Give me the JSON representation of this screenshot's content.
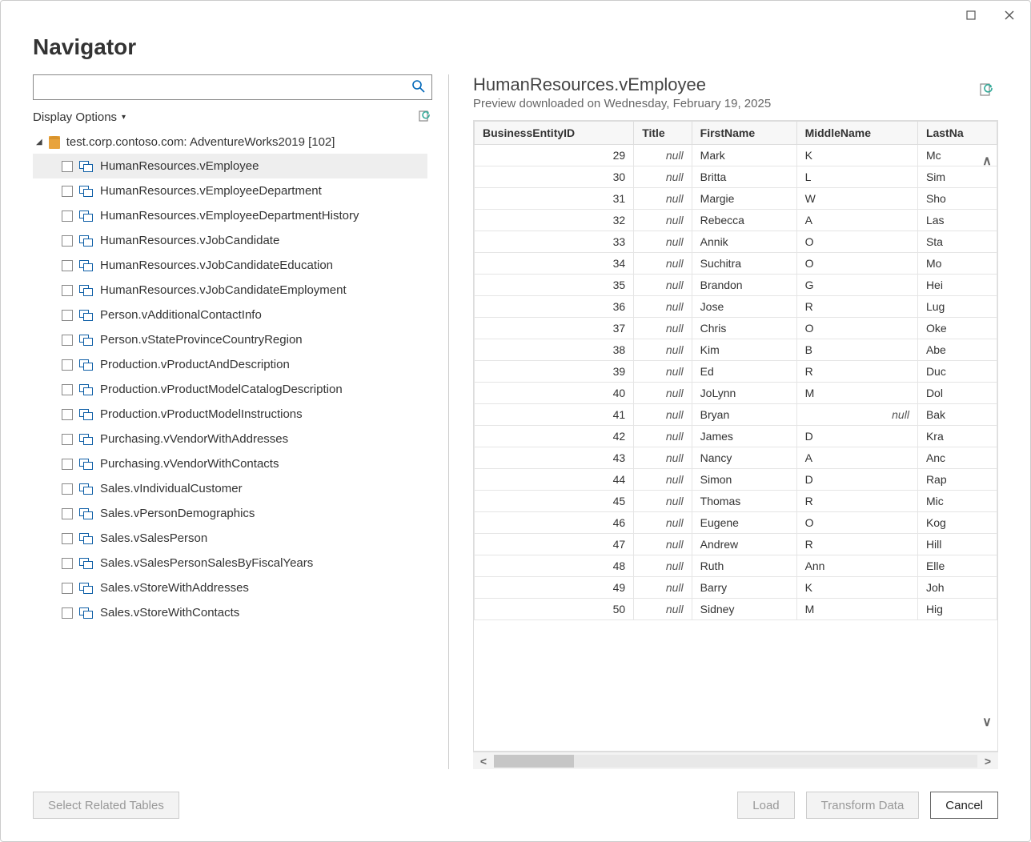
{
  "window": {
    "title": "Navigator"
  },
  "search": {
    "placeholder": ""
  },
  "displayOptions": {
    "label": "Display Options"
  },
  "tree": {
    "root": {
      "label": "test.corp.contoso.com: AdventureWorks2019 [102]"
    },
    "items": [
      {
        "label": "HumanResources.vEmployee",
        "selected": true
      },
      {
        "label": "HumanResources.vEmployeeDepartment"
      },
      {
        "label": "HumanResources.vEmployeeDepartmentHistory"
      },
      {
        "label": "HumanResources.vJobCandidate"
      },
      {
        "label": "HumanResources.vJobCandidateEducation"
      },
      {
        "label": "HumanResources.vJobCandidateEmployment"
      },
      {
        "label": "Person.vAdditionalContactInfo"
      },
      {
        "label": "Person.vStateProvinceCountryRegion"
      },
      {
        "label": "Production.vProductAndDescription"
      },
      {
        "label": "Production.vProductModelCatalogDescription"
      },
      {
        "label": "Production.vProductModelInstructions"
      },
      {
        "label": "Purchasing.vVendorWithAddresses"
      },
      {
        "label": "Purchasing.vVendorWithContacts"
      },
      {
        "label": "Sales.vIndividualCustomer"
      },
      {
        "label": "Sales.vPersonDemographics"
      },
      {
        "label": "Sales.vSalesPerson"
      },
      {
        "label": "Sales.vSalesPersonSalesByFiscalYears"
      },
      {
        "label": "Sales.vStoreWithAddresses"
      },
      {
        "label": "Sales.vStoreWithContacts"
      }
    ]
  },
  "preview": {
    "title": "HumanResources.vEmployee",
    "subtitle": "Preview downloaded on Wednesday, February 19, 2025",
    "columns": [
      "BusinessEntityID",
      "Title",
      "FirstName",
      "MiddleName",
      "LastNa"
    ],
    "rows": [
      {
        "id": "29",
        "title": null,
        "first": "Mark",
        "middle": "K",
        "last": "Mc"
      },
      {
        "id": "30",
        "title": null,
        "first": "Britta",
        "middle": "L",
        "last": "Sim"
      },
      {
        "id": "31",
        "title": null,
        "first": "Margie",
        "middle": "W",
        "last": "Sho"
      },
      {
        "id": "32",
        "title": null,
        "first": "Rebecca",
        "middle": "A",
        "last": "Las"
      },
      {
        "id": "33",
        "title": null,
        "first": "Annik",
        "middle": "O",
        "last": "Sta"
      },
      {
        "id": "34",
        "title": null,
        "first": "Suchitra",
        "middle": "O",
        "last": "Mo"
      },
      {
        "id": "35",
        "title": null,
        "first": "Brandon",
        "middle": "G",
        "last": "Hei"
      },
      {
        "id": "36",
        "title": null,
        "first": "Jose",
        "middle": "R",
        "last": "Lug"
      },
      {
        "id": "37",
        "title": null,
        "first": "Chris",
        "middle": "O",
        "last": "Oke"
      },
      {
        "id": "38",
        "title": null,
        "first": "Kim",
        "middle": "B",
        "last": "Abe"
      },
      {
        "id": "39",
        "title": null,
        "first": "Ed",
        "middle": "R",
        "last": "Duc"
      },
      {
        "id": "40",
        "title": null,
        "first": "JoLynn",
        "middle": "M",
        "last": "Dol"
      },
      {
        "id": "41",
        "title": null,
        "first": "Bryan",
        "middle": null,
        "last": "Bak"
      },
      {
        "id": "42",
        "title": null,
        "first": "James",
        "middle": "D",
        "last": "Kra"
      },
      {
        "id": "43",
        "title": null,
        "first": "Nancy",
        "middle": "A",
        "last": "Anc"
      },
      {
        "id": "44",
        "title": null,
        "first": "Simon",
        "middle": "D",
        "last": "Rap"
      },
      {
        "id": "45",
        "title": null,
        "first": "Thomas",
        "middle": "R",
        "last": "Mic"
      },
      {
        "id": "46",
        "title": null,
        "first": "Eugene",
        "middle": "O",
        "last": "Kog"
      },
      {
        "id": "47",
        "title": null,
        "first": "Andrew",
        "middle": "R",
        "last": "Hill"
      },
      {
        "id": "48",
        "title": null,
        "first": "Ruth",
        "middle": "Ann",
        "last": "Elle"
      },
      {
        "id": "49",
        "title": null,
        "first": "Barry",
        "middle": "K",
        "last": "Joh"
      },
      {
        "id": "50",
        "title": null,
        "first": "Sidney",
        "middle": "M",
        "last": "Hig"
      }
    ]
  },
  "footer": {
    "selectRelated": "Select Related Tables",
    "load": "Load",
    "transform": "Transform Data",
    "cancel": "Cancel"
  }
}
